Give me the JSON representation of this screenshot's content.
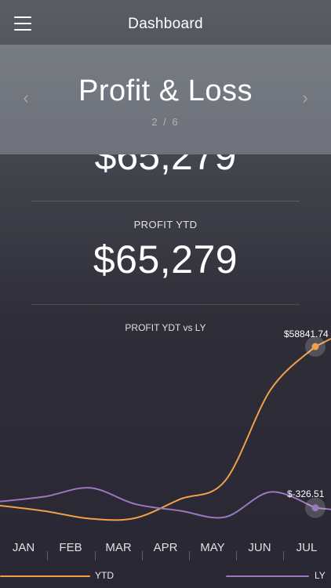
{
  "header": {
    "title": "Dashboard",
    "menu_icon": "hamburger-menu-icon"
  },
  "carousel": {
    "title": "Profit & Loss",
    "page_indicator": "2 / 6",
    "prev_icon": "chevron-left-icon",
    "next_icon": "chevron-right-icon",
    "prev_glyph": "‹",
    "next_glyph": "›"
  },
  "metrics": {
    "ghost_value": "$65,279",
    "profit_label": "PROFIT YTD",
    "profit_value": "$65,279"
  },
  "colors": {
    "ytd": "#f0a04a",
    "ly": "#9a78c0"
  },
  "chart_data": {
    "type": "line",
    "title": "PROFIT YDT vs LY",
    "categories": [
      "JAN",
      "FEB",
      "MAR",
      "APR",
      "MAY",
      "JUN",
      "JUL"
    ],
    "series": [
      {
        "name": "YTD",
        "values": [
          520,
          -1500,
          -4300,
          -4100,
          2900,
          9600,
          43000,
          58841.74
        ]
      },
      {
        "name": "LY",
        "values": [
          2000,
          3800,
          7000,
          1100,
          -1400,
          -3700,
          5500,
          -326.51
        ]
      }
    ],
    "annotations": [
      {
        "series": "YTD",
        "label": "$58841.74"
      },
      {
        "series": "LY",
        "label": "$-326.51"
      }
    ],
    "grid": false,
    "legend": "bottom"
  }
}
